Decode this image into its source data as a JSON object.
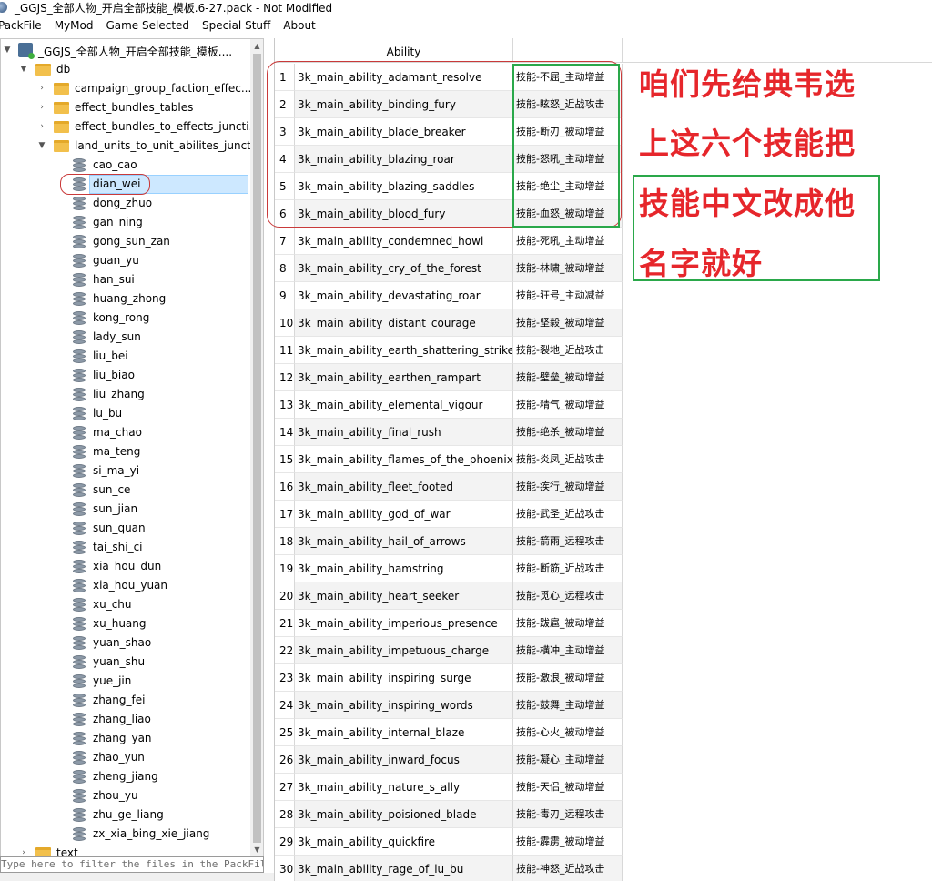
{
  "window": {
    "title": "_GGJS_全部人物_开启全部技能_模板.6-27.pack - Not Modified"
  },
  "menu": [
    {
      "label": "PackFile"
    },
    {
      "label": "MyMod"
    },
    {
      "label": "Game Selected"
    },
    {
      "label": "Special Stuff"
    },
    {
      "label": "About"
    }
  ],
  "tree": {
    "root": "_GGJS_全部人物_开启全部技能_模板....",
    "db": "db",
    "folders": [
      "campaign_group_faction_effec...",
      "effect_bundles_tables",
      "effect_bundles_to_effects_juncti...",
      "land_units_to_unit_abilites_junct..."
    ],
    "tables": [
      "cao_cao",
      "dian_wei",
      "dong_zhuo",
      "gan_ning",
      "gong_sun_zan",
      "guan_yu",
      "han_sui",
      "huang_zhong",
      "kong_rong",
      "lady_sun",
      "liu_bei",
      "liu_biao",
      "liu_zhang",
      "lu_bu",
      "ma_chao",
      "ma_teng",
      "si_ma_yi",
      "sun_ce",
      "sun_jian",
      "sun_quan",
      "tai_shi_ci",
      "xia_hou_dun",
      "xia_hou_yuan",
      "xu_chu",
      "xu_huang",
      "yuan_shao",
      "yuan_shu",
      "yue_jin",
      "zhang_fei",
      "zhang_liao",
      "zhang_yan",
      "zhao_yun",
      "zheng_jiang",
      "zhou_yu",
      "zhu_ge_liang",
      "zx_xia_bing_xie_jiang"
    ],
    "text_folder": "text",
    "selected": "dian_wei"
  },
  "filter": {
    "placeholder": "Type here to filter the files in the PackFile ..."
  },
  "table": {
    "header_ability": "Ability",
    "rows": [
      {
        "n": "1",
        "ability": "3k_main_ability_adamant_resolve",
        "cn": "技能-不屈_主动增益"
      },
      {
        "n": "2",
        "ability": "3k_main_ability_binding_fury",
        "cn": "技能-眩怒_近战攻击"
      },
      {
        "n": "3",
        "ability": "3k_main_ability_blade_breaker",
        "cn": "技能-断刃_被动增益"
      },
      {
        "n": "4",
        "ability": "3k_main_ability_blazing_roar",
        "cn": "技能-怒吼_主动增益"
      },
      {
        "n": "5",
        "ability": "3k_main_ability_blazing_saddles",
        "cn": "技能-绝尘_主动增益"
      },
      {
        "n": "6",
        "ability": "3k_main_ability_blood_fury",
        "cn": "技能-血怒_被动增益"
      },
      {
        "n": "7",
        "ability": "3k_main_ability_condemned_howl",
        "cn": "技能-死吼_主动增益"
      },
      {
        "n": "8",
        "ability": "3k_main_ability_cry_of_the_forest",
        "cn": "技能-林啸_被动增益"
      },
      {
        "n": "9",
        "ability": "3k_main_ability_devastating_roar",
        "cn": "技能-狂号_主动减益"
      },
      {
        "n": "10",
        "ability": "3k_main_ability_distant_courage",
        "cn": "技能-坚毅_被动增益"
      },
      {
        "n": "11",
        "ability": "3k_main_ability_earth_shattering_strike",
        "cn": "技能-裂地_近战攻击"
      },
      {
        "n": "12",
        "ability": "3k_main_ability_earthen_rampart",
        "cn": "技能-壁垒_被动增益"
      },
      {
        "n": "13",
        "ability": "3k_main_ability_elemental_vigour",
        "cn": "技能-精气_被动增益"
      },
      {
        "n": "14",
        "ability": "3k_main_ability_final_rush",
        "cn": "技能-绝杀_被动增益"
      },
      {
        "n": "15",
        "ability": "3k_main_ability_flames_of_the_phoenix",
        "cn": "技能-炎凤_近战攻击"
      },
      {
        "n": "16",
        "ability": "3k_main_ability_fleet_footed",
        "cn": "技能-疾行_被动增益"
      },
      {
        "n": "17",
        "ability": "3k_main_ability_god_of_war",
        "cn": "技能-武圣_近战攻击"
      },
      {
        "n": "18",
        "ability": "3k_main_ability_hail_of_arrows",
        "cn": "技能-箭雨_远程攻击"
      },
      {
        "n": "19",
        "ability": "3k_main_ability_hamstring",
        "cn": "技能-断筋_近战攻击"
      },
      {
        "n": "20",
        "ability": "3k_main_ability_heart_seeker",
        "cn": "技能-觅心_远程攻击"
      },
      {
        "n": "21",
        "ability": "3k_main_ability_imperious_presence",
        "cn": "技能-跋扈_被动增益"
      },
      {
        "n": "22",
        "ability": "3k_main_ability_impetuous_charge",
        "cn": "技能-横冲_主动增益"
      },
      {
        "n": "23",
        "ability": "3k_main_ability_inspiring_surge",
        "cn": "技能-激浪_被动增益"
      },
      {
        "n": "24",
        "ability": "3k_main_ability_inspiring_words",
        "cn": "技能-鼓舞_主动增益"
      },
      {
        "n": "25",
        "ability": "3k_main_ability_internal_blaze",
        "cn": "技能-心火_被动增益"
      },
      {
        "n": "26",
        "ability": "3k_main_ability_inward_focus",
        "cn": "技能-凝心_主动增益"
      },
      {
        "n": "27",
        "ability": "3k_main_ability_nature_s_ally",
        "cn": "技能-天侣_被动增益"
      },
      {
        "n": "28",
        "ability": "3k_main_ability_poisioned_blade",
        "cn": "技能-毒刃_远程攻击"
      },
      {
        "n": "29",
        "ability": "3k_main_ability_quickfire",
        "cn": "技能-霹雳_被动增益"
      },
      {
        "n": "30",
        "ability": "3k_main_ability_rage_of_lu_bu",
        "cn": "技能-神怒_近战攻击"
      }
    ]
  },
  "annotations": {
    "line1": "咱们先给典韦选",
    "line2": "上这六个技能把",
    "line3": "技能中文改成他",
    "line4": "名字就好"
  },
  "colors": {
    "annotation_text": "#e6262b",
    "red_outline": "#c93a3a",
    "green_outline": "#2aa84a",
    "selection": "#cde8ff"
  }
}
